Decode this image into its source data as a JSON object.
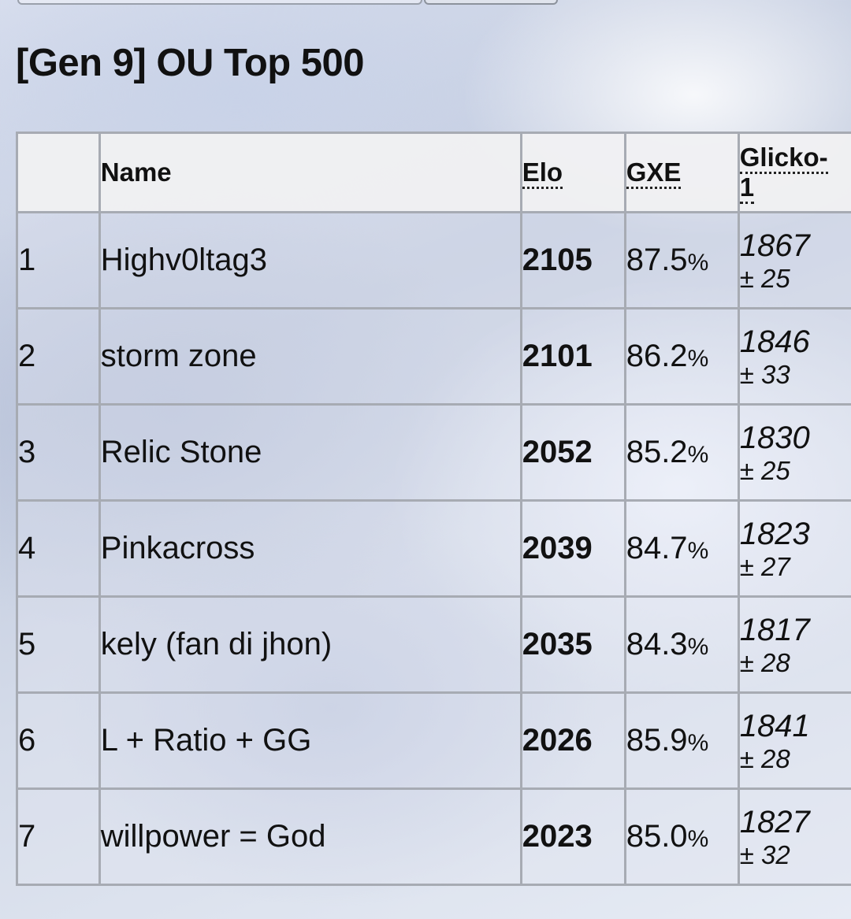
{
  "title": "[Gen 9] OU Top 500",
  "table": {
    "headers": {
      "rank": "",
      "name": "Name",
      "elo": "Elo",
      "gxe": "GXE",
      "glicko_line1": "Glicko-",
      "glicko_line2": "1"
    },
    "rows": [
      {
        "rank": "1",
        "name": "Highv0ltag3",
        "elo": "2105",
        "gxe": "87.5",
        "gxe_unit": "%",
        "glicko": "1867",
        "glicko_dev": "± 25"
      },
      {
        "rank": "2",
        "name": "storm zone",
        "elo": "2101",
        "gxe": "86.2",
        "gxe_unit": "%",
        "glicko": "1846",
        "glicko_dev": "± 33"
      },
      {
        "rank": "3",
        "name": "Relic Stone",
        "elo": "2052",
        "gxe": "85.2",
        "gxe_unit": "%",
        "glicko": "1830",
        "glicko_dev": "± 25"
      },
      {
        "rank": "4",
        "name": "Pinkacross",
        "elo": "2039",
        "gxe": "84.7",
        "gxe_unit": "%",
        "glicko": "1823",
        "glicko_dev": "± 27"
      },
      {
        "rank": "5",
        "name": "kely (fan di jhon)",
        "elo": "2035",
        "gxe": "84.3",
        "gxe_unit": "%",
        "glicko": "1817",
        "glicko_dev": "± 28"
      },
      {
        "rank": "6",
        "name": "L + Ratio + GG",
        "elo": "2026",
        "gxe": "85.9",
        "gxe_unit": "%",
        "glicko": "1841",
        "glicko_dev": "± 28"
      },
      {
        "rank": "7",
        "name": "willpower = God",
        "elo": "2023",
        "gxe": "85.0",
        "gxe_unit": "%",
        "glicko": "1827",
        "glicko_dev": "± 32"
      }
    ]
  }
}
